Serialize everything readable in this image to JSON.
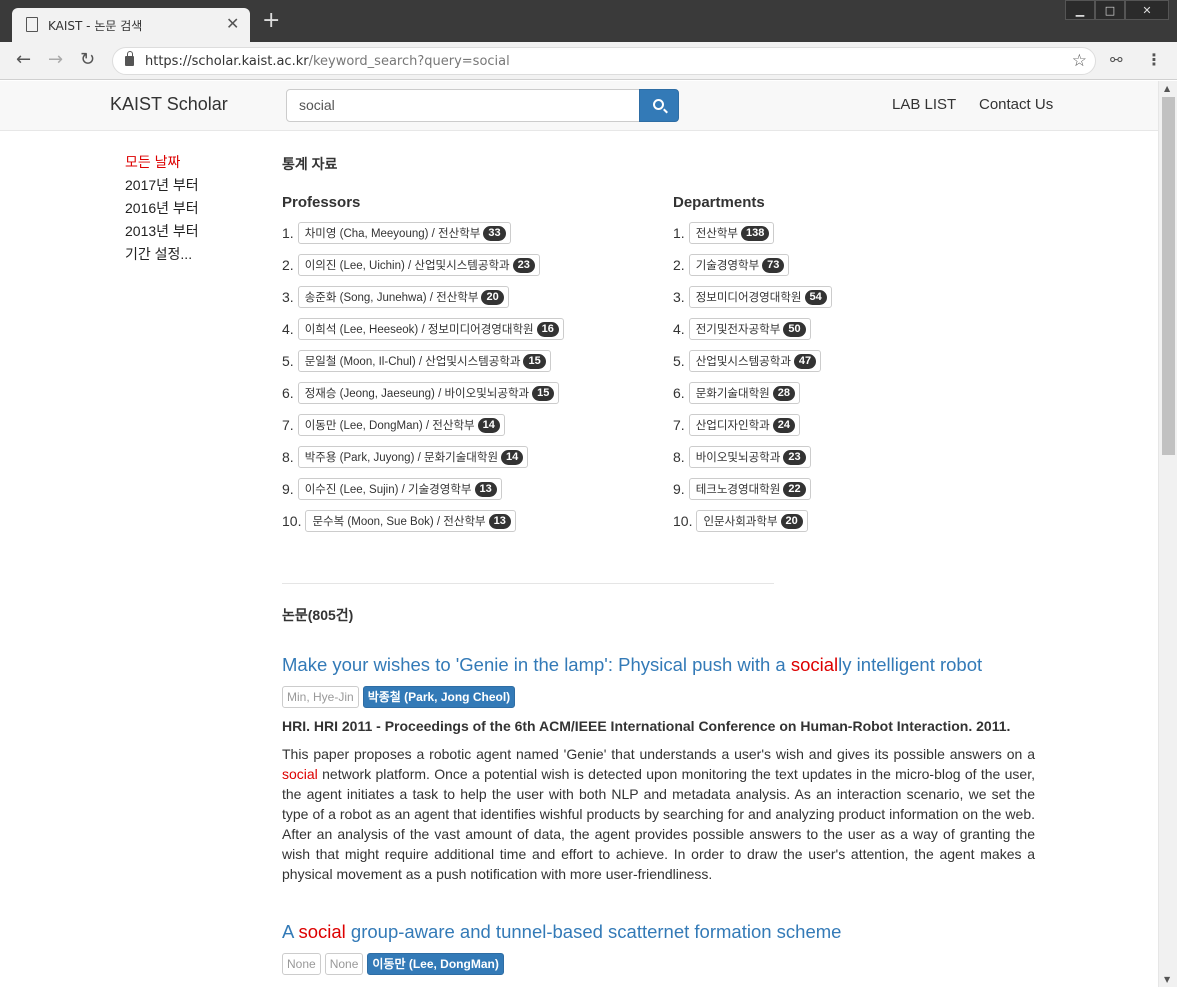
{
  "browser": {
    "tab_title": "KAIST - 논문 검색",
    "new_tab_symbol": "+",
    "url_host": "https://scholar.kaist.ac.kr",
    "url_path": "/keyword_search?query=social"
  },
  "navbar": {
    "brand": "KAIST Scholar",
    "search_value": "social",
    "links": [
      "LAB LIST",
      "Contact Us"
    ]
  },
  "sidebar": {
    "filters": [
      "모든 날짜",
      "2017년 부터",
      "2016년 부터",
      "2013년 부터",
      "기간 설정..."
    ],
    "active_index": 0
  },
  "stats": {
    "title": "통계 자료",
    "professors": {
      "title": "Professors",
      "items": [
        {
          "rank": "1.",
          "label": "차미영 (Cha, Meeyoung) / 전산학부",
          "count": "33"
        },
        {
          "rank": "2.",
          "label": "이의진 (Lee, Uichin) / 산업및시스템공학과",
          "count": "23"
        },
        {
          "rank": "3.",
          "label": "송준화 (Song, Junehwa) / 전산학부",
          "count": "20"
        },
        {
          "rank": "4.",
          "label": "이희석 (Lee, Heeseok) / 정보미디어경영대학원",
          "count": "16"
        },
        {
          "rank": "5.",
          "label": "문일철 (Moon, Il-Chul) / 산업및시스템공학과",
          "count": "15"
        },
        {
          "rank": "6.",
          "label": "정재승 (Jeong, Jaeseung) / 바이오및뇌공학과",
          "count": "15"
        },
        {
          "rank": "7.",
          "label": "이동만 (Lee, DongMan) / 전산학부",
          "count": "14"
        },
        {
          "rank": "8.",
          "label": "박주용 (Park, Juyong) / 문화기술대학원",
          "count": "14"
        },
        {
          "rank": "9.",
          "label": "이수진 (Lee, Sujin) / 기술경영학부",
          "count": "13"
        },
        {
          "rank": "10.",
          "label": "문수복 (Moon, Sue Bok) / 전산학부",
          "count": "13"
        }
      ]
    },
    "departments": {
      "title": "Departments",
      "items": [
        {
          "rank": "1.",
          "label": "전산학부",
          "count": "138"
        },
        {
          "rank": "2.",
          "label": "기술경영학부",
          "count": "73"
        },
        {
          "rank": "3.",
          "label": "정보미디어경영대학원",
          "count": "54"
        },
        {
          "rank": "4.",
          "label": "전기및전자공학부",
          "count": "50"
        },
        {
          "rank": "5.",
          "label": "산업및시스템공학과",
          "count": "47"
        },
        {
          "rank": "6.",
          "label": "문화기술대학원",
          "count": "28"
        },
        {
          "rank": "7.",
          "label": "산업디자인학과",
          "count": "24"
        },
        {
          "rank": "8.",
          "label": "바이오및뇌공학과",
          "count": "23"
        },
        {
          "rank": "9.",
          "label": "테크노경영대학원",
          "count": "22"
        },
        {
          "rank": "10.",
          "label": "인문사회과학부",
          "count": "20"
        }
      ]
    }
  },
  "papers": {
    "title": "논문(805건)",
    "items": [
      {
        "title_pre": "Make your wishes to 'Genie in the lamp': Physical push with a ",
        "title_hl": "social",
        "title_post": "ly intelligent robot",
        "authors": [
          {
            "name": "Min, Hye-Jin",
            "primary": false
          },
          {
            "name": "박종철 (Park, Jong Cheol)",
            "primary": true
          }
        ],
        "venue": "HRI. HRI 2011 - Proceedings of the 6th ACM/IEEE International Conference on Human-Robot Interaction. 2011.",
        "abstract_pre": "This paper proposes a robotic agent named 'Genie' that understands a user's wish and gives its possible answers on a ",
        "abstract_hl": "social",
        "abstract_post": " network platform. Once a potential wish is detected upon monitoring the text updates in the micro-blog of the user, the agent initiates a task to help the user with both NLP and metadata analysis. As an interaction scenario, we set the type of a robot as an agent that identifies wishful products by searching for and analyzing product information on the web. After an analysis of the vast amount of data, the agent provides possible answers to the user as a way of granting the wish that might require additional time and effort to achieve. In order to draw the user's attention, the agent makes a physical movement as a push notification with more user-friendliness."
      },
      {
        "title_pre": "A ",
        "title_hl": "social",
        "title_post": " group-aware and tunnel-based scatternet formation scheme",
        "authors": [
          {
            "name": "None",
            "primary": false
          },
          {
            "name": "None",
            "primary": false
          },
          {
            "name": "이동만 (Lee, DongMan)",
            "primary": true
          }
        ]
      }
    ]
  },
  "colors": {
    "link": "#337ab7",
    "highlight": "#dd0000",
    "badge": "#333333"
  }
}
